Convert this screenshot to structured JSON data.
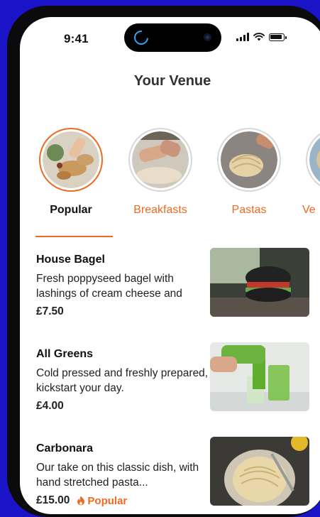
{
  "status_bar": {
    "time": "9:41"
  },
  "header": {
    "title": "Your Venue"
  },
  "categories": [
    {
      "label": "Popular",
      "selected": true
    },
    {
      "label": "Breakfasts",
      "selected": false
    },
    {
      "label": "Pastas",
      "selected": false
    },
    {
      "label": "Ve",
      "selected": false
    }
  ],
  "menu_items": [
    {
      "name": "House Bagel",
      "description": "Fresh poppyseed bagel with lashings of cream cheese and",
      "price": "£7.50",
      "tag": ""
    },
    {
      "name": "All Greens",
      "description": "Cold pressed and freshly prepared, kickstart your day.",
      "price": "£4.00",
      "tag": ""
    },
    {
      "name": "Carbonara",
      "description": "Our take on this classic dish, with hand stretched pasta...",
      "price": "£15.00",
      "tag": "Popular"
    }
  ],
  "colors": {
    "accent": "#ee6a22",
    "background": "#1a13c8",
    "text": "#111111"
  },
  "icons": [
    "loading-spinner-icon",
    "camera-icon",
    "signal-icon",
    "wifi-icon",
    "battery-icon",
    "flame-icon"
  ]
}
